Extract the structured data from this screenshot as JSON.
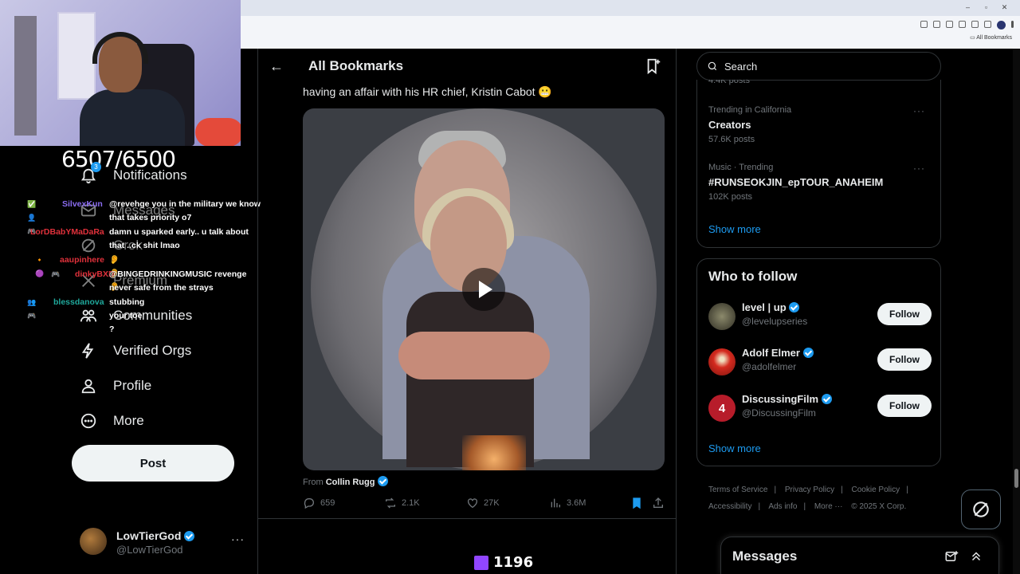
{
  "browser": {
    "bookmarks_label": "All Bookmarks",
    "window_controls": [
      "–",
      "▫",
      "✕"
    ]
  },
  "stream": {
    "sub_counter": "6507/6500",
    "viewer_count": "1196"
  },
  "nav": {
    "notifications_label": "Notifications",
    "notifications_badge": "3",
    "messages_label": "Messages",
    "grok_label": "Grok",
    "premium_label": "Premium",
    "communities_label": "Communities",
    "verified_orgs_label": "Verified Orgs",
    "profile_label": "Profile",
    "more_label": "More",
    "post_label": "Post"
  },
  "account": {
    "name": "LowTierGod",
    "handle": "@LowTierGod",
    "more": "···"
  },
  "chat": [
    {
      "user": "SilvexKun",
      "color": "#8a6cf0",
      "msg": "@revehge you in the military we know that takes priority o7"
    },
    {
      "user": "LorDBabYMaDaRa",
      "color": "#e0313b",
      "msg": "damn u sparked early.. u talk about that ..ck shit lmao"
    },
    {
      "user": "aaupinhere",
      "color": "#e0313b",
      "msg": "👂 👂 👂"
    },
    {
      "user": "dinkyBXD",
      "color": "#e0313b",
      "msg": "@BINGEDRINKINGMUSIC revenge never safe from the strays"
    },
    {
      "user": "blessdanova",
      "color": "#1fa89b",
      "msg": "stubbing your toe ?"
    }
  ],
  "main": {
    "title": "All Bookmarks",
    "tweet_text": "having an affair with his HR chief, Kristin Cabot 😬",
    "from_prefix": "From",
    "from_name": "Collin Rugg",
    "replies": "659",
    "reposts": "2.1K",
    "likes": "27K",
    "views": "3.6M"
  },
  "search": {
    "placeholder": "Search"
  },
  "trends": [
    {
      "meta": "Trending in California",
      "name": "Creators",
      "posts": "57.6K posts"
    },
    {
      "meta": "Music · Trending",
      "name": "#RUNSEOKJIN_epTOUR_ANAHEIM",
      "posts": "102K posts"
    }
  ],
  "trends_partial_posts": "4.4K posts",
  "trends_show_more": "Show more",
  "who_to_follow": {
    "title": "Who to follow",
    "items": [
      {
        "name": "level | up",
        "handle": "@levelupseries",
        "button": "Follow",
        "avatar_color": "#4a4a3a"
      },
      {
        "name": "Adolf Elmer",
        "handle": "@adolfelmer",
        "button": "Follow",
        "avatar_color": "#c8201c"
      },
      {
        "name": "DiscussingFilm",
        "handle": "@DiscussingFilm",
        "button": "Follow",
        "avatar_color": "#b71c2a"
      }
    ],
    "show_more": "Show more"
  },
  "footer": {
    "links": [
      "Terms of Service",
      "Privacy Policy",
      "Cookie Policy",
      "Accessibility",
      "Ads info",
      "More ···"
    ],
    "copyright": "© 2025 X Corp."
  },
  "messages_drawer": {
    "title": "Messages"
  },
  "colors": {
    "accent": "#1d9bf0",
    "background": "#000000",
    "border": "#2f3336",
    "muted": "#71767b"
  }
}
